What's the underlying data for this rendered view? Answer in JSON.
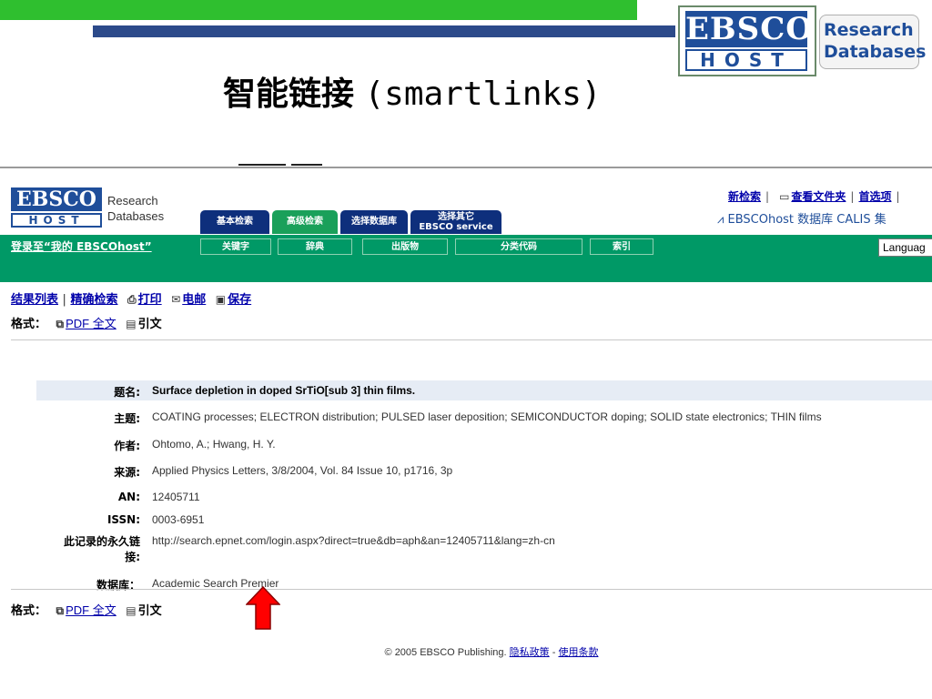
{
  "slide": {
    "title_zh": "智能链接",
    "title_en": "(smartlinks)",
    "logo": {
      "top": "EBSCO",
      "bottom": "HOST",
      "tag_line1": "Research",
      "tag_line2": "Databases"
    }
  },
  "site": {
    "logo": {
      "top": "EBSCO",
      "bottom": "HOST",
      "tag_line1": "Research",
      "tag_line2": "Databases"
    },
    "tabs": [
      {
        "label": "基本检索",
        "style": "blue"
      },
      {
        "label": "高级检索",
        "style": "green"
      },
      {
        "label": "选择数据库",
        "style": "blue"
      },
      {
        "label1": "选择其它",
        "label2": "EBSCO service",
        "style": "blue"
      }
    ],
    "toplinks": [
      "新检索",
      "查看文件夹",
      "首选项"
    ],
    "calis": "EBSCOhost 数据库 CALIS 集",
    "login_link": "登录至“我的 EBSCOhost”",
    "subtabs": [
      "关键字",
      "辞典",
      "出版物",
      "分类代码",
      "索引"
    ],
    "language": "Languag"
  },
  "actions": {
    "results_list": "结果列表",
    "refine": "精确检索",
    "print": "打印",
    "email": "电邮",
    "save": "保存"
  },
  "format": {
    "label": "格式：",
    "pdf": "PDF 全文",
    "citation": "引文"
  },
  "record": {
    "title": {
      "label": "题名:",
      "value": "Surface depletion in doped SrTiO[sub 3] thin films."
    },
    "subject": {
      "label": "主题:",
      "value": "COATING processes; ELECTRON distribution; PULSED laser deposition; SEMICONDUCTOR doping; SOLID state electronics; THIN films"
    },
    "authors": {
      "label": "作者:",
      "value": "Ohtomo, A.; Hwang, H. Y."
    },
    "source": {
      "label": "来源:",
      "value": "Applied Physics Letters, 3/8/2004, Vol. 84 Issue 10, p1716, 3p"
    },
    "an": {
      "label": "AN:",
      "value": "12405711"
    },
    "issn": {
      "label": "ISSN:",
      "value": "0003-6951"
    },
    "permalink": {
      "label1": "此记录的永久链",
      "label2": "接:",
      "value": "http://search.epnet.com/login.aspx?direct=true&db=aph&an=12405711&lang=zh-cn"
    },
    "database": {
      "label": "数据库：",
      "value": "Academic Search Premier"
    }
  },
  "footer": {
    "copyright": "© 2005 EBSCO Publishing.",
    "privacy": "隐私政策",
    "dash": " - ",
    "terms": "使用条款"
  },
  "colors": {
    "slide_green": "#2fbf2f",
    "slide_blue": "#2c4a8a",
    "site_green": "#009966",
    "tab_blue": "#0e2f7c",
    "arrow_red": "#ff0000"
  }
}
